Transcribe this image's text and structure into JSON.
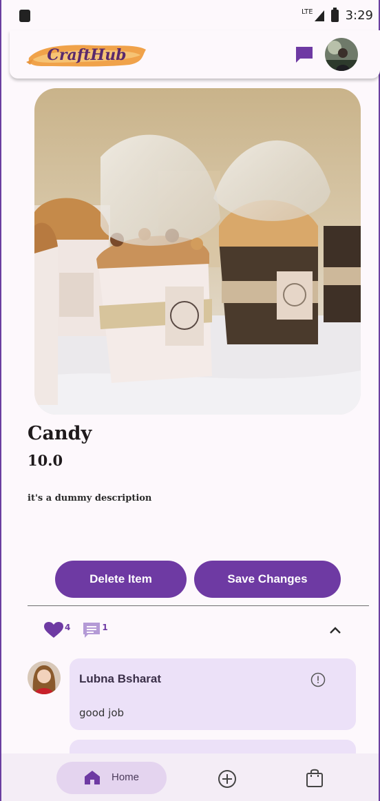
{
  "status_bar": {
    "network": "LTE",
    "time": "3:29"
  },
  "app_bar": {
    "logo_text": "CraftHub"
  },
  "product": {
    "name": "Candy",
    "price": "10.0",
    "description": "it's a dummy description"
  },
  "actions": {
    "delete_label": "Delete Item",
    "save_label": "Save Changes"
  },
  "stats": {
    "likes": "4",
    "comments": "1"
  },
  "comments": [
    {
      "author": "Lubna Bsharat",
      "text": "good job"
    }
  ],
  "bottom_nav": {
    "home_label": "Home"
  },
  "colors": {
    "accent": "#6e3aa3",
    "card": "#ece1f8",
    "background": "#fdf8fc"
  }
}
